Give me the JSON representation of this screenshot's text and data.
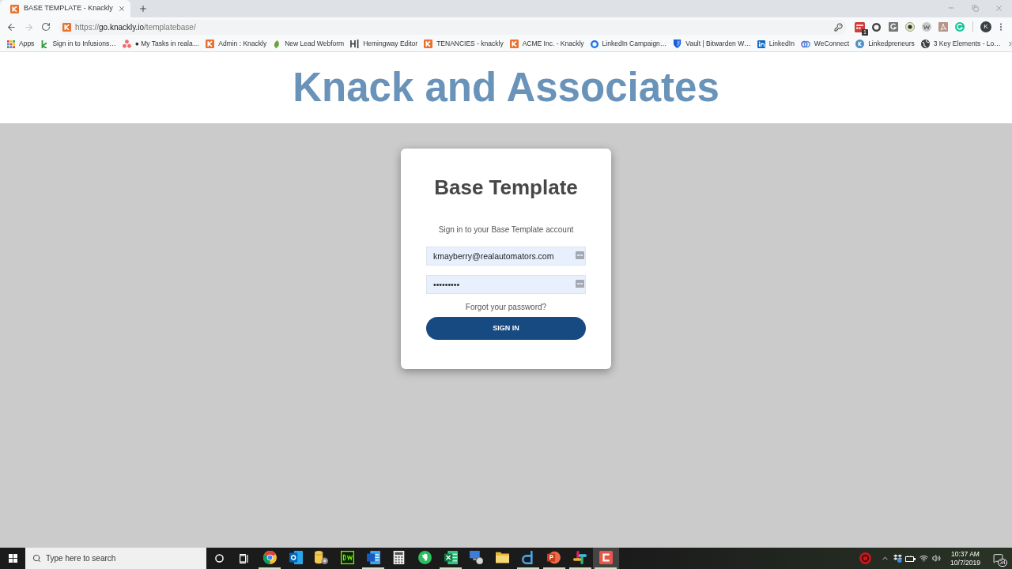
{
  "browser": {
    "tabs": [
      {
        "title": "BASE TEMPLATE - Knackly",
        "selected": true
      }
    ],
    "forward_disabled": true,
    "url": "https://go.knackly.io/templatebase/",
    "extensions": [
      {
        "kind": "calendar",
        "badge": "1"
      },
      {
        "kind": "ring"
      },
      {
        "kind": "g-tile"
      },
      {
        "kind": "eye"
      },
      {
        "kind": "w-circle"
      },
      {
        "kind": "pdf"
      },
      {
        "kind": "grammarly"
      }
    ],
    "profile_initial": "K",
    "bookmarks": [
      {
        "label": "Apps",
        "kind": "apps"
      },
      {
        "label": "Sign in to Infusions…",
        "kind": "k-letter"
      },
      {
        "label": "● My Tasks in reala…",
        "kind": "dots"
      },
      {
        "label": "Admin : Knackly",
        "kind": "knackly"
      },
      {
        "label": "New Lead Webform",
        "kind": "leaf"
      },
      {
        "label": "Hemingway Editor",
        "kind": "hemingway"
      },
      {
        "label": "TENANCIES - knackly",
        "kind": "knackly"
      },
      {
        "label": "ACME Inc. - Knackly",
        "kind": "knackly"
      },
      {
        "label": "LinkedIn Campaign…",
        "kind": "ring-c"
      },
      {
        "label": "Vault | Bitwarden W…",
        "kind": "shield"
      },
      {
        "label": "LinkedIn",
        "kind": "linkedin"
      },
      {
        "label": "WeConnect",
        "kind": "weconnect"
      },
      {
        "label": "Linkedpreneurs",
        "kind": "k-circle"
      },
      {
        "label": "3 Key Elements - Lo…",
        "kind": "globe"
      }
    ]
  },
  "header": {
    "logo": "Knack and Associates"
  },
  "login": {
    "title": "Base Template",
    "subtitle": "Sign in to your Base Template account",
    "fields": [
      {
        "value": "kmayberry@realautomators.com"
      },
      {
        "value": "•••••••••"
      }
    ],
    "forgot_link": "Forgot your password?",
    "button": "SIGN IN"
  },
  "taskbar": {
    "search": {
      "placeholder": "Type here to search"
    },
    "apps": [
      {
        "kind": "chrome",
        "running": true,
        "selected": false
      },
      {
        "kind": "outlook",
        "running": false,
        "selected": false
      },
      {
        "kind": "database",
        "running": false,
        "selected": false
      },
      {
        "kind": "dreamweaver",
        "running": false,
        "selected": false
      },
      {
        "kind": "word",
        "running": true,
        "selected": false
      },
      {
        "kind": "calculator",
        "running": false,
        "selected": false
      },
      {
        "kind": "evernote",
        "running": false,
        "selected": false
      },
      {
        "kind": "excel",
        "running": true,
        "selected": false
      },
      {
        "kind": "network",
        "running": false,
        "selected": false
      },
      {
        "kind": "folder",
        "running": false,
        "selected": false
      },
      {
        "kind": "d-app",
        "running": true,
        "selected": false
      },
      {
        "kind": "powerpoint",
        "running": true,
        "selected": false
      },
      {
        "kind": "slack",
        "running": true,
        "selected": false
      },
      {
        "kind": "c-app",
        "running": true,
        "selected": true
      }
    ],
    "time": "10:37 AM",
    "date": "10/7/2019",
    "notification_count": "34"
  }
}
